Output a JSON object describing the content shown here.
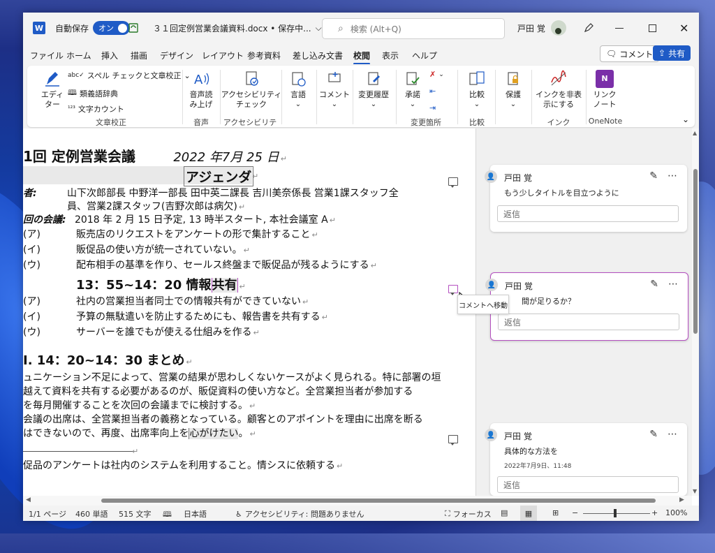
{
  "titlebar": {
    "app_logo": "W",
    "autosave_label": "自動保存",
    "autosave_state": "オン",
    "doc_title": "３１回定例営業会議資料.docx • 保存中...",
    "search_placeholder": "検索 (Alt+Q)",
    "user_name": "戸田 覚"
  },
  "tabs": [
    "ファイル",
    "ホーム",
    "挿入",
    "描画",
    "デザイン",
    "レイアウト",
    "参考資料",
    "差し込み文書",
    "校閲",
    "表示",
    "ヘルプ"
  ],
  "active_tab": "校閲",
  "buttons": {
    "comment": "コメント",
    "share": "共有"
  },
  "ribbon": {
    "editor": "エディ\nター",
    "spell": "スペル チェックと文章校正",
    "thesaurus": "類義語辞典",
    "wordcount": "文字カウント",
    "group_proofing": "文章校正",
    "readaloud": "音声読\nみ上げ",
    "group_voice": "音声",
    "accessibility": "アクセシビリティ\nチェック",
    "group_accessibility": "アクセシビリティ",
    "language": "言語",
    "comments": "コメント",
    "trackchanges": "変更履歴",
    "accept": "承諾",
    "group_changes": "変更箇所",
    "compare": "比較",
    "group_compare": "比較",
    "protect": "保護",
    "hideink": "インクを非表\n示にする",
    "group_ink": "インク",
    "linkednotes": "リンク\nノート",
    "group_onenote": "OneNote"
  },
  "document": {
    "title": "1回 定例営業会議",
    "date": "2022 年7月 25 日",
    "agenda": "アジェンダ",
    "attendees_label": "者:",
    "attendees_1": "山下次郎部長 中野洋一部長 田中英二課長 吉川美奈係長 営業1課スタッフ全",
    "attendees_2": "員、営業2課スタッフ(吉野次郎は病欠)",
    "prev_label": "回の会議:",
    "prev_text": "2018 年 2 月 15 日予定, 13 時半スタート, 本社会議室 A",
    "items_a": [
      {
        "num": "(ア)",
        "text": "販売店のリクエストをアンケートの形で集計すること"
      },
      {
        "num": "(イ)",
        "text": "販促品の使い方が統一されていない。"
      },
      {
        "num": "(ウ)",
        "text": "配布相手の基準を作り、セールス終盤まで販促品が残るようにする"
      }
    ],
    "section2_heading_pre": "13：55~14：20 情報",
    "section2_heading_hl": "共有",
    "items_b": [
      {
        "num": "(ア)",
        "text": "社内の営業担当者同士での情報共有ができていない"
      },
      {
        "num": "(イ)",
        "text": "予算の無駄遣いを防止するためにも、報告書を共有する"
      },
      {
        "num": "(ウ)",
        "text": "サーバーを誰でもが使える仕組みを作る"
      }
    ],
    "section3_heading": "I. 14：20~14：30 まとめ",
    "summary_1": "ュニケーション不足によって、営業の結果が思わしくないケースがよく見られる。特に部署の垣",
    "summary_2": "越えて資料を共有する必要があるのが、販促資料の使い方など。全営業担当者が参加する",
    "summary_3": "を毎月開催することを次回の会議までに検討する。",
    "summary_4": "会議の出席は、全営業担当者の義務となっている。顧客とのアポイントを理由に出席を断る",
    "summary_5_pre": "はできないので、再度、出席率向上を",
    "summary_5_hl": "心がけたい",
    "summary_5_post": "。",
    "footnote": "促品のアンケートは社内のシステムを利用すること。情シスに依頼する"
  },
  "comments": [
    {
      "author": "戸田 覚",
      "text": "もう少しタイトルを目立つように",
      "reply": "返信"
    },
    {
      "author": "戸田 覚",
      "text": "間が足りるか？",
      "reply": "返信"
    },
    {
      "author": "戸田 覚",
      "text": "具体的な方法を",
      "date": "2022年7月9日、11:48",
      "reply": "返信"
    }
  ],
  "tooltip": "コメントへ移動",
  "status": {
    "page": "1/1 ページ",
    "words": "460 単語",
    "chars": "515 文字",
    "lang": "日本語",
    "accessibility": "アクセシビリティ: 問題ありません",
    "focus": "フォーカス",
    "zoom": "100%"
  },
  "colors": {
    "accent": "#1f5bc6",
    "comment_border": "#b44fc0",
    "highlight": "#e9e9e9"
  }
}
